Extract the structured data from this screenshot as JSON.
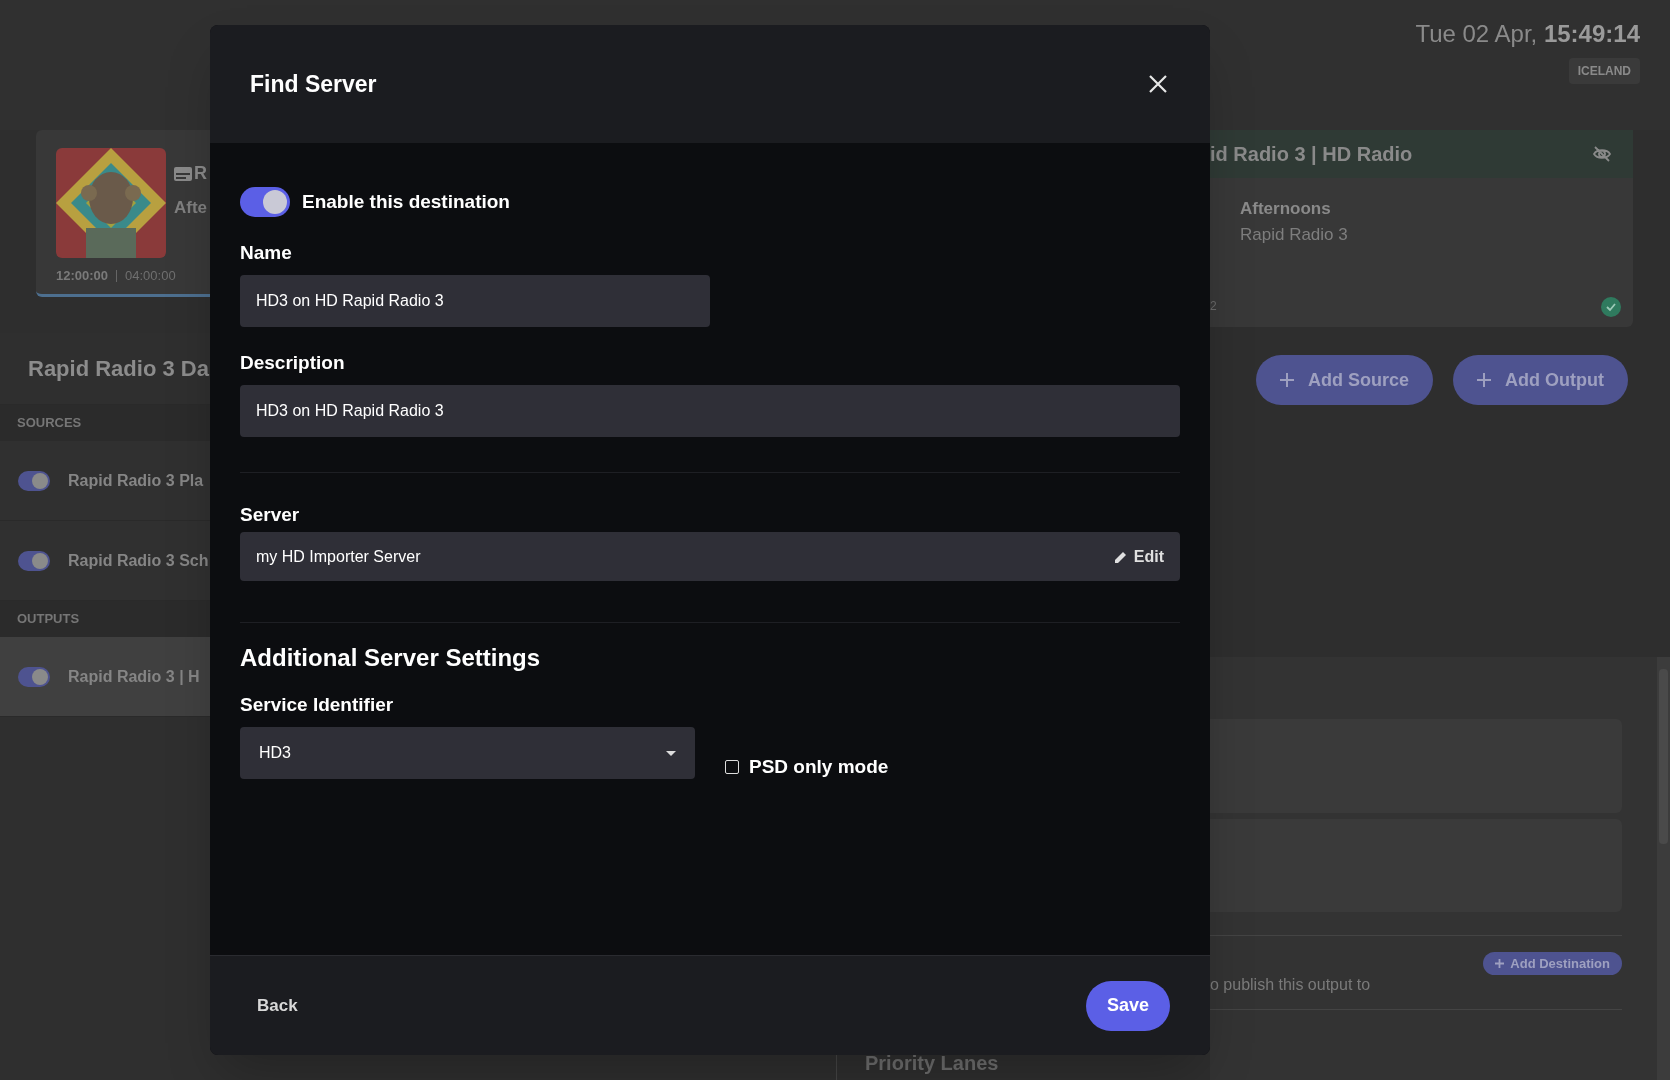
{
  "clock": {
    "date": "Tue 02 Apr,",
    "time": "15:49:14",
    "zone": "ICELAND"
  },
  "now_playing": {
    "kind": "picture",
    "title": "R",
    "subtitle": "Afte",
    "start": "12:00:00",
    "duration": "04:00:00"
  },
  "panel": {
    "title": "Rapid Radio 3 Da",
    "sections": [
      {
        "heading": "SOURCES",
        "items": [
          {
            "label": "Rapid Radio 3 Pla",
            "on": true,
            "selected": false
          },
          {
            "label": "Rapid Radio 3 Sch",
            "on": true,
            "selected": false
          }
        ]
      },
      {
        "heading": "OUTPUTS",
        "items": [
          {
            "label": "Rapid Radio 3 | H",
            "on": true,
            "selected": true
          }
        ]
      }
    ]
  },
  "output_card": {
    "title": "id Radio 3 | HD Radio",
    "show": "Afternoons",
    "station": "Rapid Radio 3",
    "fragment": "2",
    "healthy": true
  },
  "actions": [
    "Add Source",
    "Add Output"
  ],
  "destinations": {
    "add_label": "Add Destination",
    "hint": "o publish this output to"
  },
  "priority": {
    "title": "Priority Lanes"
  },
  "dialog": {
    "title": "Find Server",
    "enable": {
      "label": "Enable this destination",
      "on": true
    },
    "name": {
      "label": "Name",
      "value": "HD3 on HD Rapid Radio 3"
    },
    "description": {
      "label": "Description",
      "value": "HD3 on HD Rapid Radio 3"
    },
    "server": {
      "label": "Server",
      "value": "my HD Importer Server",
      "action": "Edit"
    },
    "section_title": "Additional Server Settings",
    "service_identifier": {
      "label": "Service Identifier",
      "value": "HD3"
    },
    "psd": {
      "label": "PSD only mode",
      "checked": false
    },
    "back": "Back",
    "save": "Save"
  }
}
